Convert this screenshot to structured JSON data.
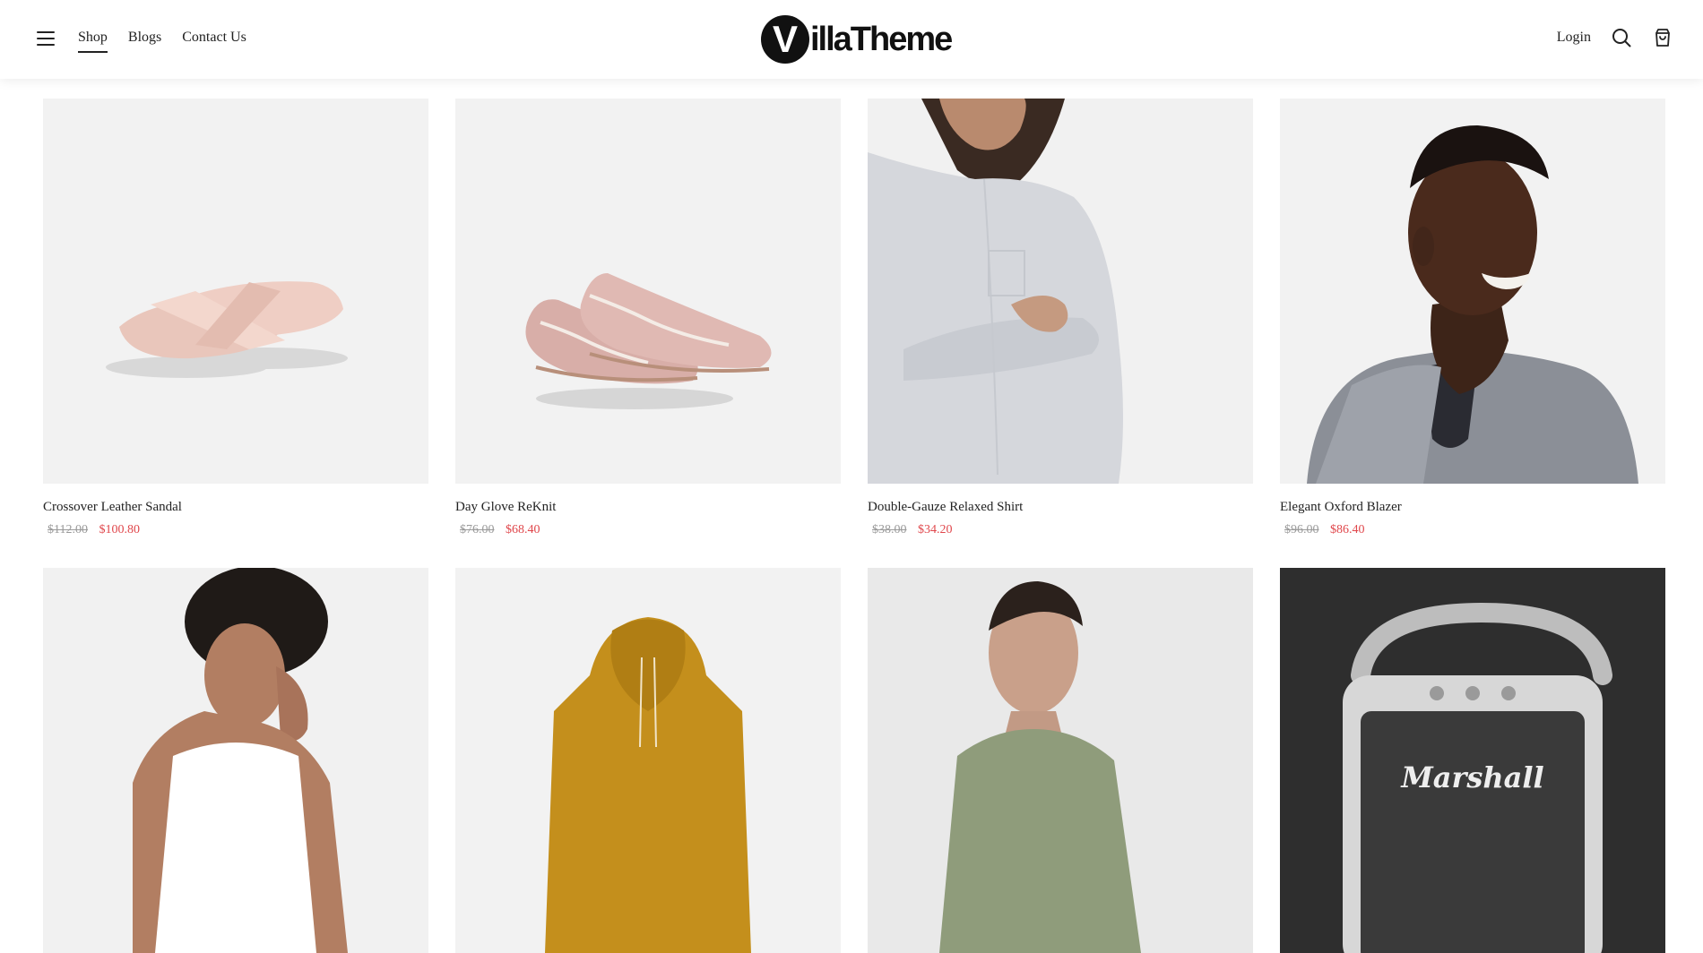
{
  "header": {
    "nav": [
      {
        "label": "Shop",
        "active": true
      },
      {
        "label": "Blogs",
        "active": false
      },
      {
        "label": "Contact Us",
        "active": false
      }
    ],
    "logo": {
      "letter": "V",
      "text": "illaTheme"
    },
    "login_label": "Login",
    "icons": {
      "menu": "hamburger-icon",
      "search": "search-icon",
      "cart": "shopping-bag-icon"
    }
  },
  "products": [
    {
      "title": "Crossover Leather Sandal",
      "old_price": "$112.00",
      "new_price": "$100.80",
      "image": "pink-sandals"
    },
    {
      "title": "Day Glove ReKnit",
      "old_price": "$76.00",
      "new_price": "$68.40",
      "image": "pink-flats"
    },
    {
      "title": "Double-Gauze Relaxed Shirt",
      "old_price": "$38.00",
      "new_price": "$34.20",
      "image": "woman-grey-shirt"
    },
    {
      "title": "Elegant Oxford Blazer",
      "old_price": "$96.00",
      "new_price": "$86.40",
      "image": "man-grey-blazer"
    },
    {
      "title": "",
      "old_price": "",
      "new_price": "",
      "image": "woman-white-tank"
    },
    {
      "title": "",
      "old_price": "",
      "new_price": "",
      "image": "mustard-hoodie"
    },
    {
      "title": "",
      "old_price": "",
      "new_price": "",
      "image": "man-green-jacket"
    },
    {
      "title": "",
      "old_price": "",
      "new_price": "",
      "image": "marshall-speaker",
      "brand_text": "Marshall"
    }
  ],
  "colors": {
    "sale": "#e0474c",
    "old_price": "#9a9a9a",
    "thumb_bg": "#f2f2f2"
  }
}
